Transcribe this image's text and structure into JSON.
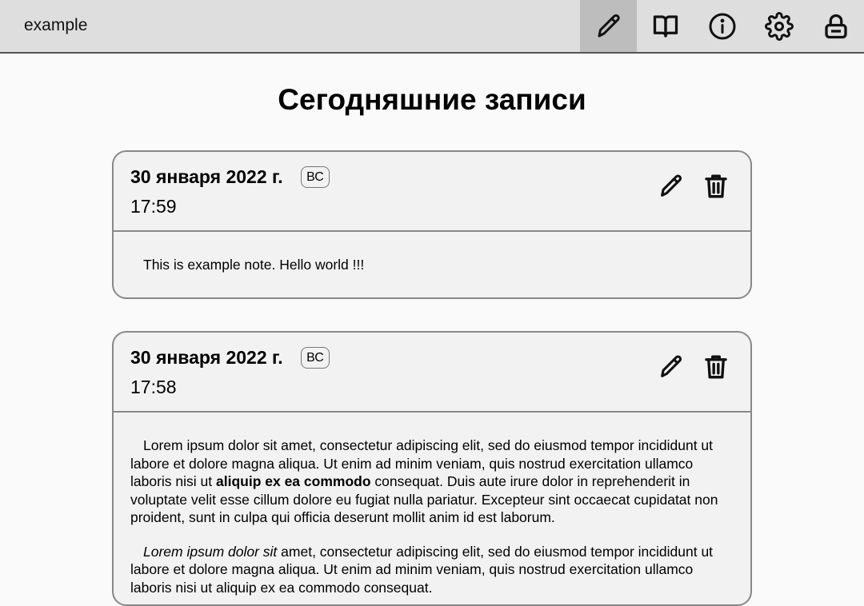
{
  "app": {
    "title": "example"
  },
  "nav": [
    {
      "name": "write",
      "icon": "pencil-icon",
      "active": true
    },
    {
      "name": "read",
      "icon": "book-icon",
      "active": false
    },
    {
      "name": "info",
      "icon": "info-icon",
      "active": false
    },
    {
      "name": "settings",
      "icon": "gear-icon",
      "active": false
    },
    {
      "name": "lock",
      "icon": "lock-icon",
      "active": false
    }
  ],
  "main": {
    "title": "Сегодняшние записи",
    "entries": [
      {
        "date": "30 января 2022 г.",
        "weekday": "ВС",
        "time": "17:59",
        "text": "This is example note. Hello world !!!"
      },
      {
        "date": "30 января 2022 г.",
        "weekday": "ВС",
        "time": "17:58",
        "p1_start": "Lorem ipsum dolor sit amet, consectetur adipiscing elit, sed do eiusmod tempor incididunt ut labore et dolore magna aliqua. Ut enim ad minim veniam, quis nostrud exercitation ullamco laboris nisi ut ",
        "p1_bold": "aliquip ex ea commodo",
        "p1_end": " consequat. Duis aute irure dolor in reprehenderit in voluptate velit esse cillum dolore eu fugiat nulla pariatur. Excepteur sint occaecat cupidatat non proident, sunt in culpa qui officia deserunt mollit anim id est laborum.",
        "p2_italic": "Lorem ipsum dolor sit",
        "p2_rest": " amet, consectetur adipiscing elit, sed do eiusmod tempor incididunt ut labore et dolore magna aliqua. Ut enim ad minim veniam, quis nostrud exercitation ullamco laboris nisi ut aliquip ex ea commodo consequat."
      }
    ]
  }
}
